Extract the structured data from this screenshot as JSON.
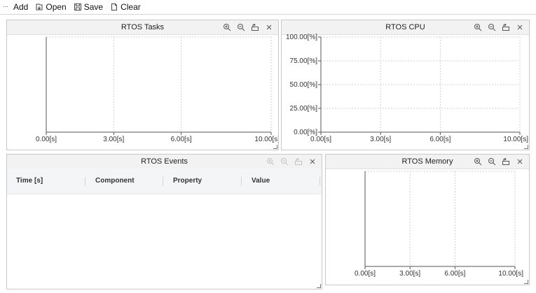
{
  "toolbar": {
    "add_label": "Add",
    "open_label": "Open",
    "save_label": "Save",
    "clear_label": "Clear"
  },
  "panels": {
    "tasks": {
      "title": "RTOS Tasks",
      "x_ticks": [
        "0.00[s]",
        "3.00[s]",
        "6.00[s]",
        "10.00[s]"
      ]
    },
    "cpu": {
      "title": "RTOS CPU",
      "x_ticks": [
        "0.00[s]",
        "3.00[s]",
        "6.00[s]",
        "10.00[s]"
      ],
      "y_ticks": [
        "0.00[%]",
        "25.00[%]",
        "50.00[%]",
        "75.00[%]",
        "100.00[%]"
      ]
    },
    "events": {
      "title": "RTOS Events",
      "columns": [
        "Time [s]",
        "Component",
        "Property",
        "Value"
      ]
    },
    "memory": {
      "title": "RTOS Memory",
      "x_ticks": [
        "0.00[s]",
        "3.00[s]",
        "6.00[s]",
        "10.00[s]"
      ]
    }
  },
  "icons": {
    "zoom_in": "zoom-in-icon",
    "zoom_out": "zoom-out-icon",
    "undock": "undock-icon",
    "close": "close-icon"
  }
}
